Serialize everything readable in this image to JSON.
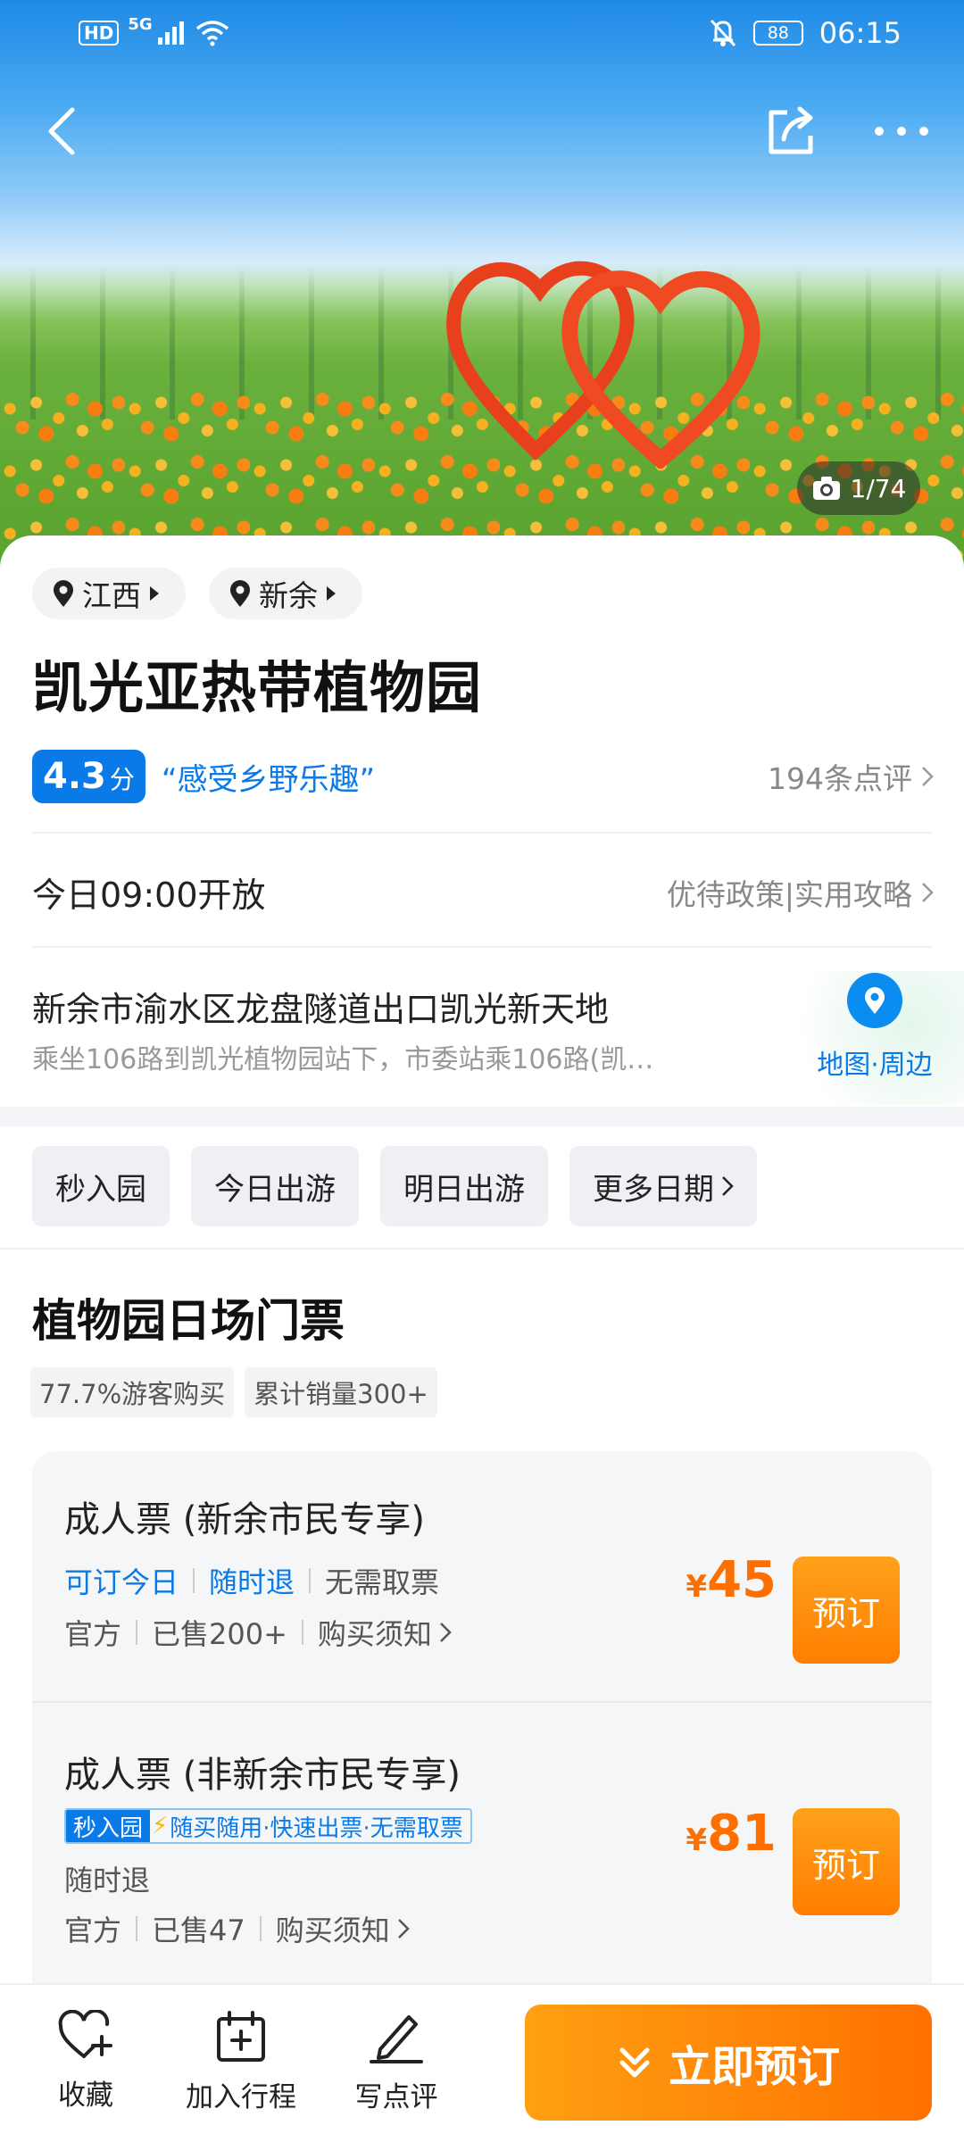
{
  "status_bar": {
    "hd_label": "HD",
    "network_label": "5G",
    "battery": "88",
    "time": "06:15"
  },
  "hero": {
    "photo_count": "1/74"
  },
  "location": {
    "province": "江西",
    "city": "新余"
  },
  "attraction": {
    "title": "凯光亚热带植物园",
    "score": "4.3",
    "score_unit": "分",
    "slogan": "“感受乡野乐趣”",
    "review_count": "194条点评",
    "hours": "今日09:00开放",
    "policy_link": "优待政策|实用攻略",
    "address": "新余市渝水区龙盘隧道出口凯光新天地",
    "transit": "乘坐106路到凯光植物园站下，市委站乘106路(凯…",
    "map_label": "地图·周边"
  },
  "date_tabs": [
    "秒入园",
    "今日出游",
    "明日出游",
    "更多日期"
  ],
  "section": {
    "title": "植物园日场门票",
    "tags": [
      "77.7%游客购买",
      "累计销量300+"
    ]
  },
  "tickets": [
    {
      "name": "成人票 (新余市民专享)",
      "features": [
        "可订今日",
        "随时退",
        "无需取票"
      ],
      "source": "官方",
      "sold": "已售200+",
      "notice": "购买须知",
      "currency": "¥",
      "price": "45",
      "book_label": "预订"
    },
    {
      "name": "成人票 (非新余市民专享)",
      "fast_key": "秒入园",
      "fast_desc": "随买随用·快速出票·无需取票",
      "refund": "随时退",
      "source": "官方",
      "sold": "已售47",
      "notice": "购买须知",
      "currency": "¥",
      "price": "81",
      "book_label": "预订"
    }
  ],
  "bottom_bar": {
    "favorite": "收藏",
    "add_trip": "加入行程",
    "review": "写点评",
    "cta": "立即预订"
  },
  "colors": {
    "accent_blue": "#0a7ae8",
    "accent_orange": "#ff7e00"
  }
}
